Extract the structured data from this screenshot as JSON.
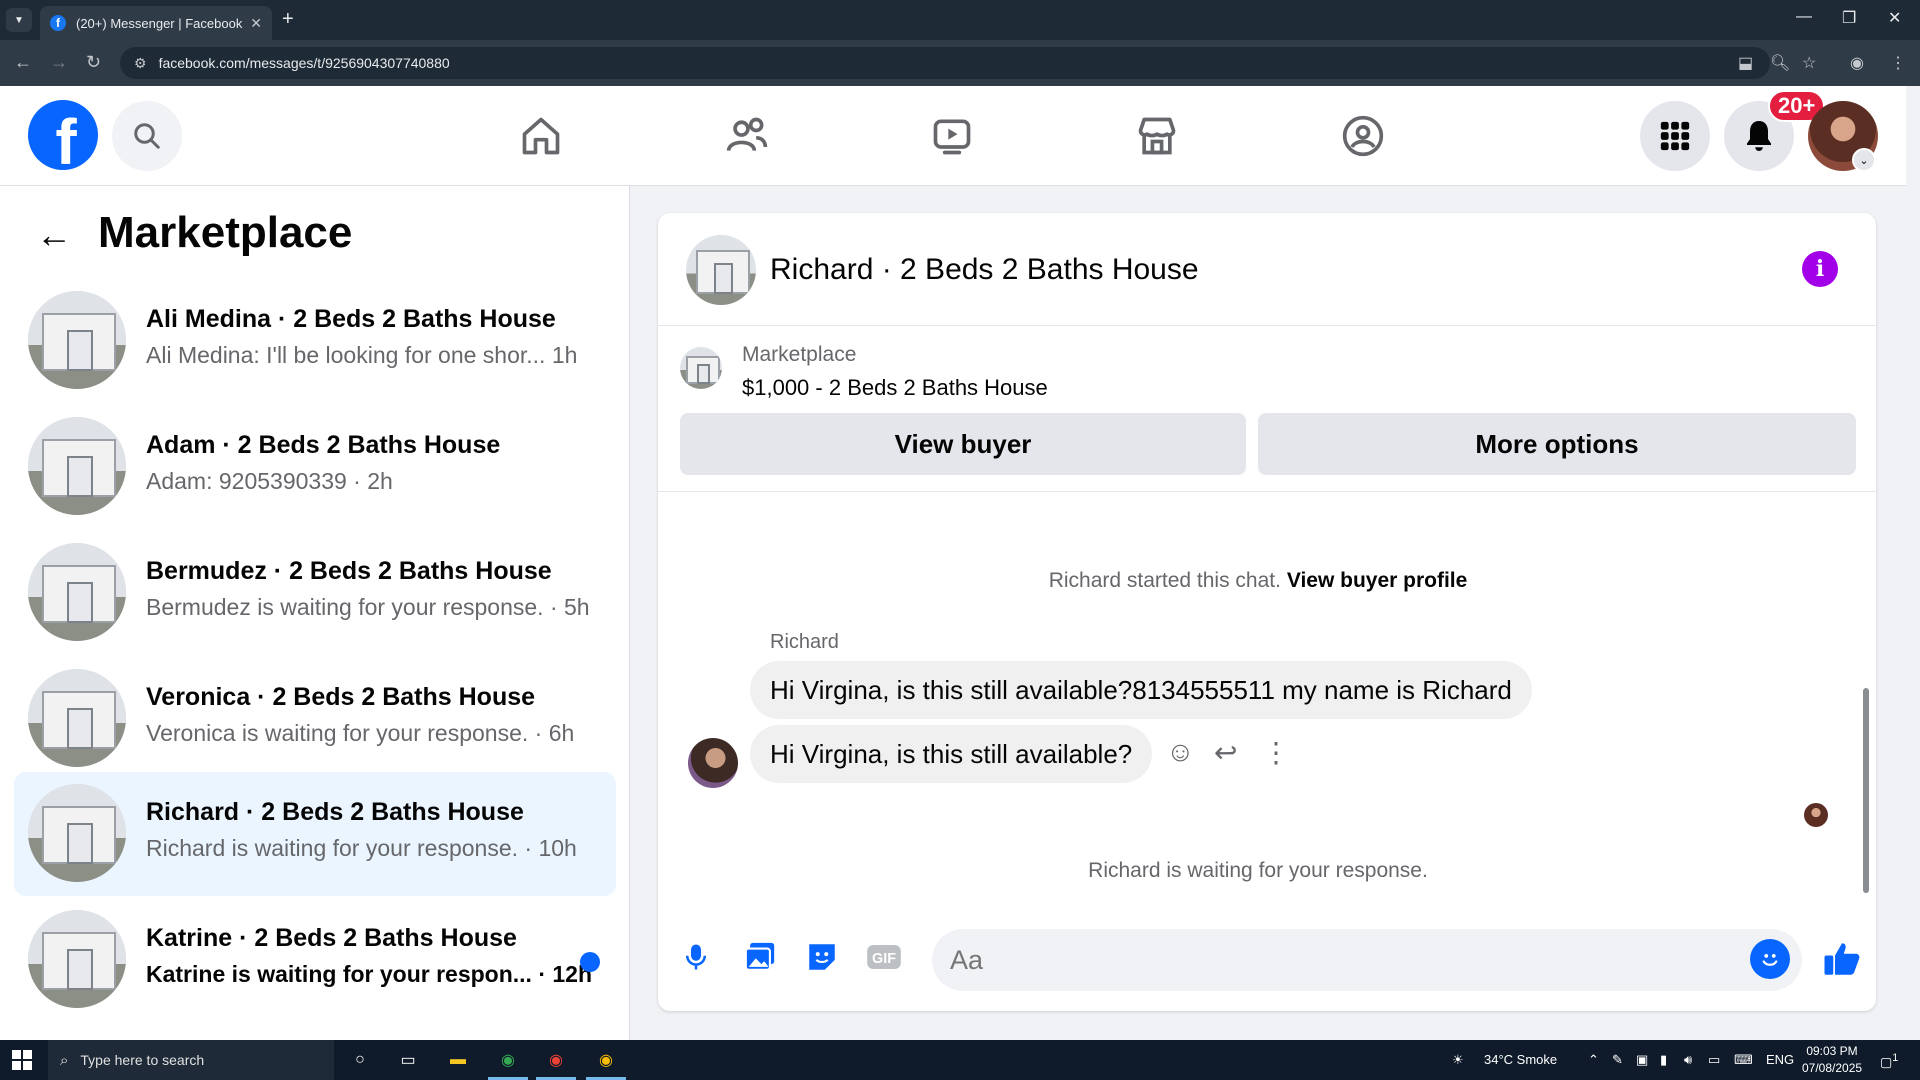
{
  "browser": {
    "tab_title": "(20+) Messenger | Facebook",
    "url": "facebook.com/messages/t/9256904307740880",
    "tab_close": "✕",
    "new_tab": "+"
  },
  "header": {
    "notification_badge": "20+",
    "logo_letter": "f"
  },
  "left_panel": {
    "title": "Marketplace",
    "conversations": [
      {
        "name": "Ali Medina · 2 Beds 2 Baths House",
        "snippet": "Ali Medina: I'll be looking for one shor... 1h",
        "selected": false,
        "unread": false
      },
      {
        "name": "Adam · 2 Beds 2 Baths House",
        "snippet": "Adam: 9205390339 · 2h",
        "selected": false,
        "unread": false
      },
      {
        "name": "Bermudez · 2 Beds 2 Baths House",
        "snippet": "Bermudez is waiting for your response. · 5h",
        "selected": false,
        "unread": false
      },
      {
        "name": "Veronica · 2 Beds 2 Baths House",
        "snippet": "Veronica is waiting for your response. · 6h",
        "selected": false,
        "unread": false
      },
      {
        "name": "Richard · 2 Beds 2 Baths House",
        "snippet": "Richard is waiting for your response. · 10h",
        "selected": true,
        "unread": false
      },
      {
        "name": "Katrine · 2 Beds 2 Baths House",
        "snippet": "Katrine is waiting for your respon... · 12h",
        "selected": false,
        "unread": true
      }
    ]
  },
  "chat": {
    "title": "Richard · 2 Beds 2 Baths House",
    "info_glyph": "i",
    "marketplace_label": "Marketplace",
    "listing": "$1,000 - 2 Beds 2 Baths House",
    "view_buyer_label": "View buyer",
    "more_options_label": "More options",
    "started_text": "Richard started this chat.",
    "view_profile_link": "View buyer profile",
    "sender_name": "Richard",
    "messages": [
      "Hi Virgina, is this still available?8134555511 my name is Richard",
      "Hi Virgina, is this still available?"
    ],
    "waiting_text": "Richard is waiting for your response.",
    "composer_placeholder": "Aa"
  },
  "taskbar": {
    "search_placeholder": "Type here to search",
    "weather": "34°C  Smoke",
    "language": "ENG",
    "time": "09:03 PM",
    "date": "07/08/2025",
    "notification_count": "1"
  },
  "colors": {
    "fb_blue": "#0866ff",
    "info_purple": "#a200e8",
    "badge_red": "#e41e3f",
    "selected_bg": "#ebf5ff"
  }
}
